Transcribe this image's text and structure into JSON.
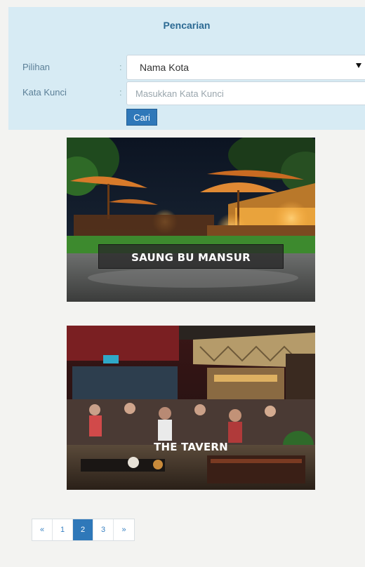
{
  "search": {
    "title": "Pencarian",
    "option_label": "Pilihan",
    "keyword_label": "Kata Kunci",
    "colon": ":",
    "selected_option": "Nama Kota",
    "keyword_placeholder": "Masukkan Kata Kunci",
    "keyword_value": "",
    "button_label": "Cari"
  },
  "results": [
    {
      "name": "SAUNG BU MANSUR"
    },
    {
      "name": "THE TAVERN"
    }
  ],
  "pagination": {
    "prev": "«",
    "pages": [
      "1",
      "2",
      "3"
    ],
    "next": "»",
    "active_page": "2"
  }
}
